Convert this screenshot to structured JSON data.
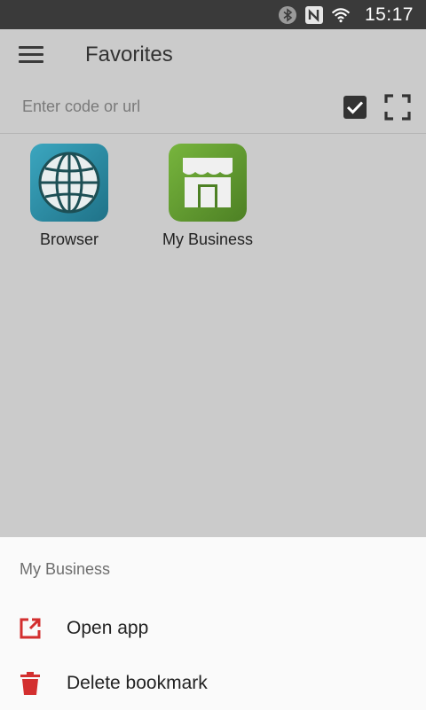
{
  "status_bar": {
    "time": "15:17",
    "icons": [
      "bluetooth-icon",
      "nfc-icon",
      "wifi-icon"
    ]
  },
  "app_bar": {
    "menu_icon": "hamburger-menu-icon",
    "title": "Favorites"
  },
  "search": {
    "placeholder": "Enter code or url",
    "value": "",
    "confirm_icon": "checkbox-check-icon",
    "scan_icon": "scan-frame-icon"
  },
  "favorites": [
    {
      "label": "Browser",
      "icon": "globe-icon",
      "color": "#2e8fa6"
    },
    {
      "label": "My Business",
      "icon": "storefront-icon",
      "color": "#5f9b2e"
    }
  ],
  "bottom_sheet": {
    "title": "My Business",
    "items": [
      {
        "label": "Open app",
        "icon": "open-external-icon"
      },
      {
        "label": "Delete bookmark",
        "icon": "trash-icon"
      }
    ],
    "accent_color": "#d32f2f"
  }
}
